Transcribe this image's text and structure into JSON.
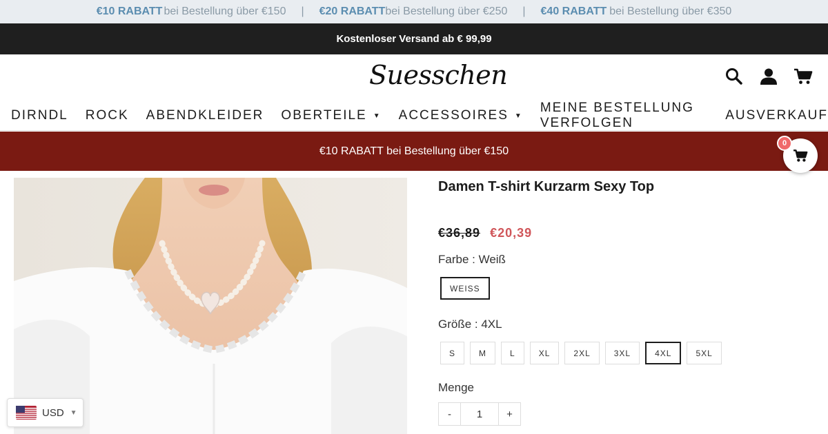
{
  "promo_bar": {
    "items": [
      {
        "amount": "€10 RABATT",
        "text": "bei Bestellung über €150"
      },
      {
        "amount": "€20 RABATT",
        "text": "bei Bestellung über €250"
      },
      {
        "amount": "€40 RABATT",
        "text": "bei Bestellung über €350"
      }
    ],
    "separator": "|"
  },
  "shipping_bar": {
    "text": "Kostenloser Versand ab € 99,99"
  },
  "header": {
    "logo": "Suesschen",
    "icons": [
      "search-icon",
      "account-icon",
      "cart-icon"
    ]
  },
  "nav": {
    "items": [
      {
        "label": "DIRNDL"
      },
      {
        "label": "ROCK"
      },
      {
        "label": "ABENDKLEIDER"
      },
      {
        "label": "OBERTEILE",
        "caret": "▼"
      },
      {
        "label": "ACCESSOIRES",
        "caret": "▼"
      },
      {
        "label": "MEINE BESTELLUNG VERFOLGEN"
      },
      {
        "label": "AUSVERKAUF"
      }
    ]
  },
  "sale_banner": {
    "text": "€10 RABATT bei Bestellung über €150"
  },
  "floating_cart": {
    "count": "0"
  },
  "product": {
    "title": "Damen T-shirt Kurzarm Sexy Top",
    "price_old": "€36,89",
    "price_new": "€20,39",
    "color_label": "Farbe : Weiß",
    "color_options": [
      "WEISS"
    ],
    "size_label": "Größe : 4XL",
    "size_options": [
      "S",
      "M",
      "L",
      "XL",
      "2XL",
      "3XL",
      "4XL",
      "5XL"
    ],
    "size_selected": "4XL",
    "quantity_label": "Menge",
    "quantity": {
      "minus": "-",
      "value": "1",
      "plus": "+"
    }
  },
  "currency": {
    "code": "USD"
  },
  "colors": {
    "accent_red": "#7a1a12",
    "price_red": "#d0565a",
    "promo_blue": "#5b8db0"
  }
}
